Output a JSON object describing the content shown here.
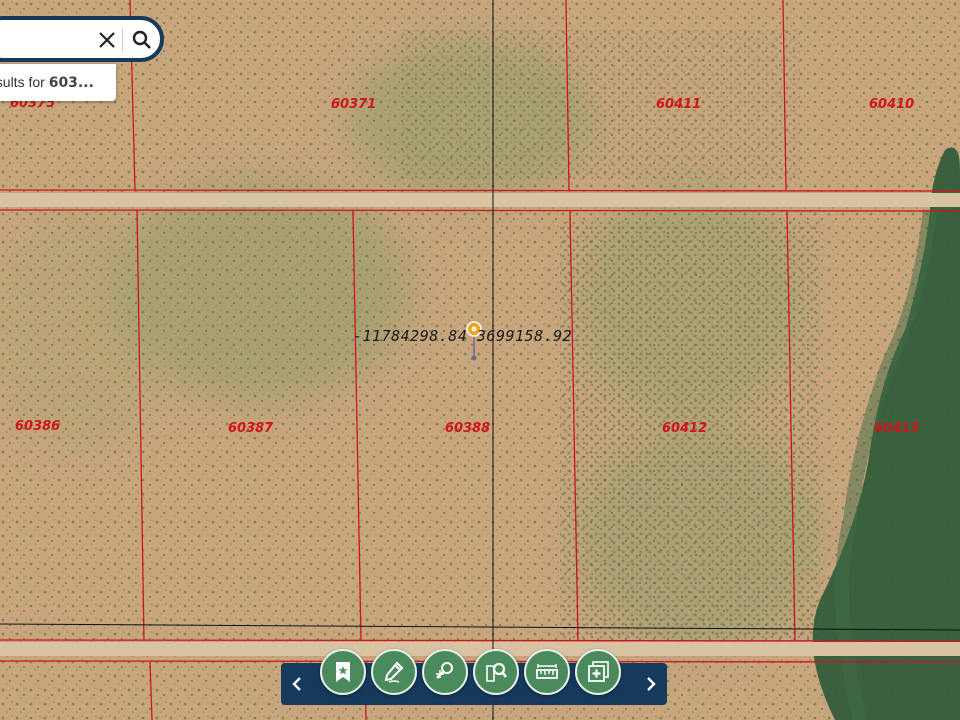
{
  "map": {
    "parcels": [
      {
        "id": "p60375",
        "label": "60375"
      },
      {
        "id": "p60371",
        "label": "60371"
      },
      {
        "id": "p60411",
        "label": "60411"
      },
      {
        "id": "p60410",
        "label": "60410"
      },
      {
        "id": "p60386",
        "label": "60386"
      },
      {
        "id": "p60387",
        "label": "60387"
      },
      {
        "id": "p60388",
        "label": "60388"
      },
      {
        "id": "p60412",
        "label": "60412"
      },
      {
        "id": "p60413",
        "label": "60413"
      }
    ],
    "coordinate_readout": "-11784298.84 3699158.92",
    "colors": {
      "parcel_line": "#d0151c",
      "terrain": "#c9a57e",
      "vegetation": "#5d7a4a",
      "dark_vegetation": "#2f5a38",
      "road": "#d8c3a2"
    }
  },
  "search": {
    "clear_icon": "close-icon",
    "search_icon": "search-icon",
    "results_prefix": "esults for ",
    "results_query": "603..."
  },
  "toolbar": {
    "colors": {
      "bar": "#163a5c",
      "button": "#4b8a5c"
    },
    "tools": [
      {
        "name": "bookmark-tool",
        "icon": "bookmark-icon"
      },
      {
        "name": "draw-tool",
        "icon": "pencil-icon"
      },
      {
        "name": "identify-tool",
        "icon": "identify-icon"
      },
      {
        "name": "query-tool",
        "icon": "document-search-icon"
      },
      {
        "name": "measure-tool",
        "icon": "ruler-icon"
      },
      {
        "name": "add-data-tool",
        "icon": "add-layers-icon"
      }
    ],
    "prev_icon": "chevron-left-icon",
    "next_icon": "chevron-right-icon"
  }
}
